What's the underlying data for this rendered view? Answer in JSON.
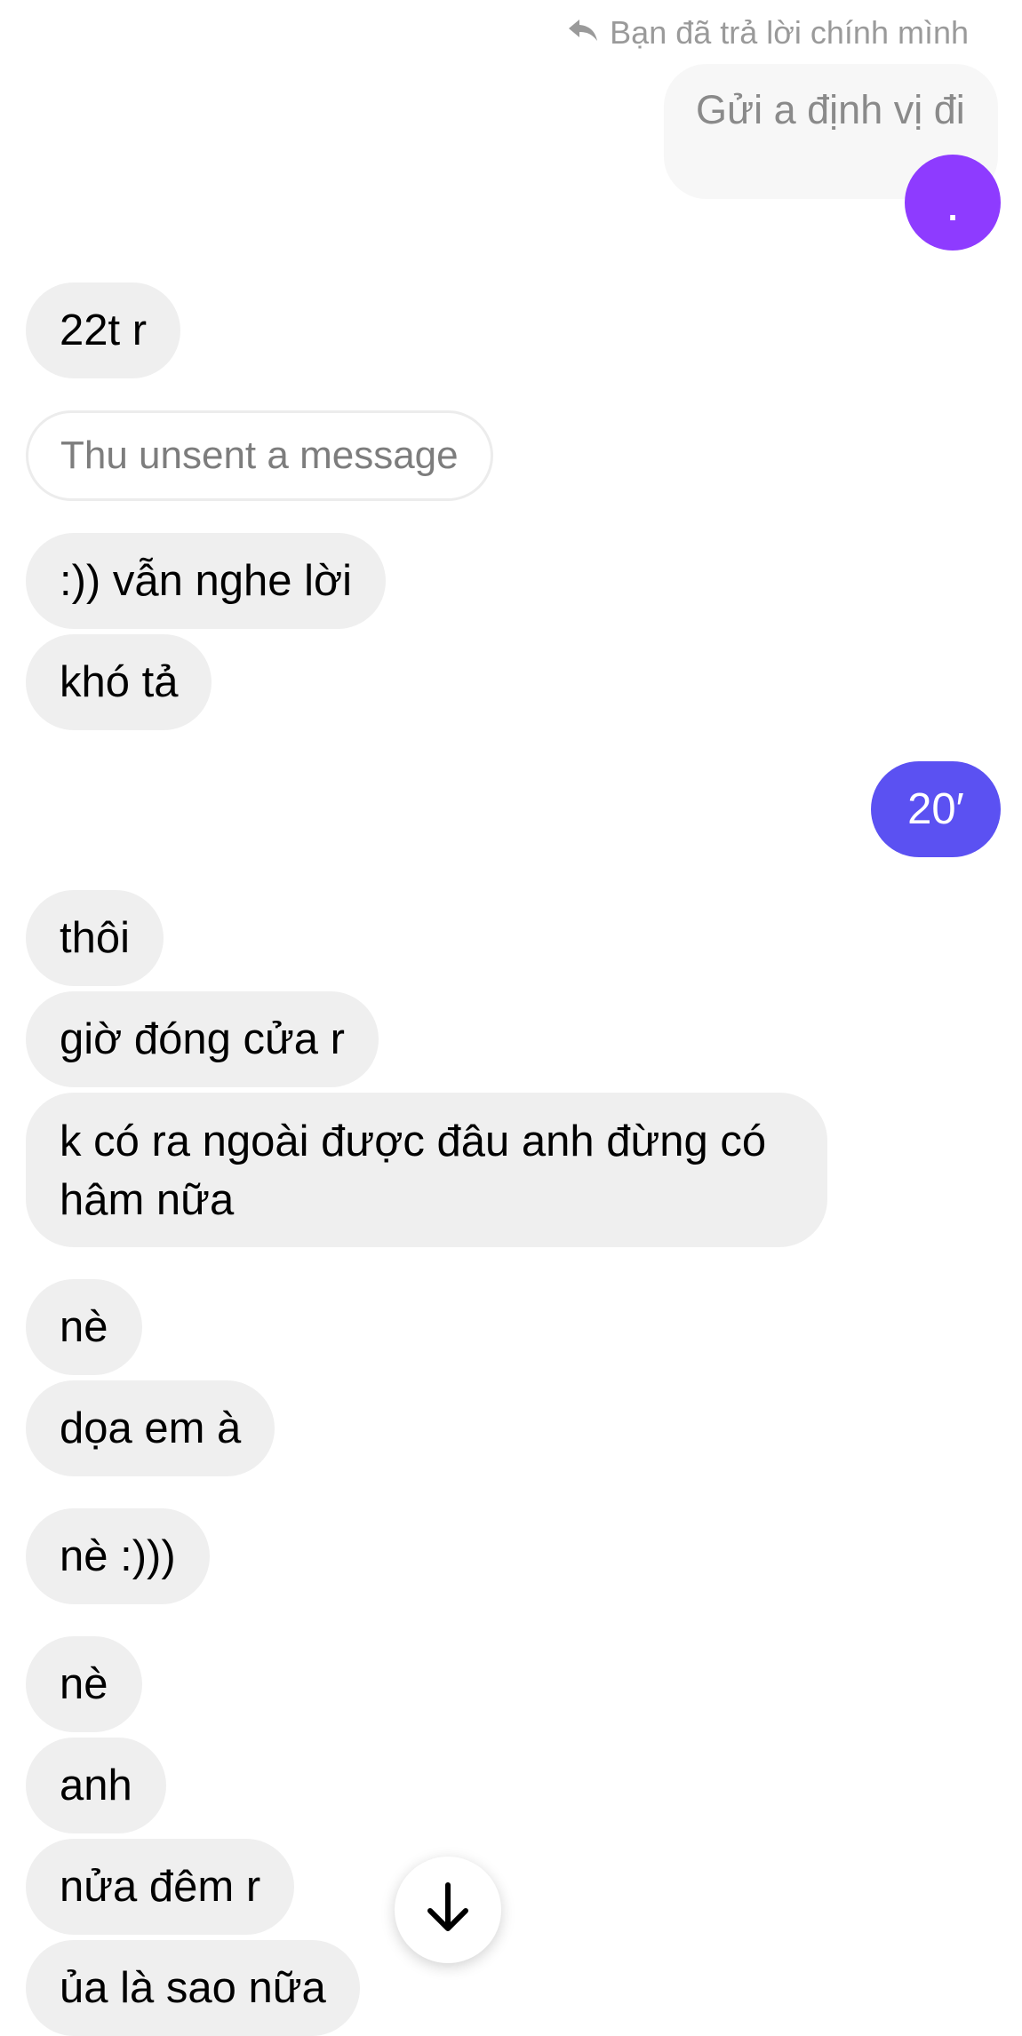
{
  "reply_context": {
    "note": "Bạn đã trả lời chính mình",
    "quoted_text": "Gửi a định vị đi",
    "sent_text": "."
  },
  "messages": [
    {
      "side": "received",
      "text": "22t r"
    },
    {
      "side": "system",
      "text": "Thu unsent a message"
    },
    {
      "side": "received",
      "text": ":)) vẫn nghe lời"
    },
    {
      "side": "received",
      "text": "khó tả"
    },
    {
      "side": "sent",
      "text": "20′"
    },
    {
      "side": "received",
      "text": "thôi"
    },
    {
      "side": "received",
      "text": "giờ đóng cửa r"
    },
    {
      "side": "received",
      "text": "k có ra ngoài được đâu anh đừng có hâm nữa"
    },
    {
      "side": "received",
      "text": "nè"
    },
    {
      "side": "received",
      "text": "dọa em à"
    },
    {
      "side": "received",
      "text": "nè :)))"
    },
    {
      "side": "received",
      "text": "nè"
    },
    {
      "side": "received",
      "text": "anh"
    },
    {
      "side": "received",
      "text": "nửa đêm r"
    },
    {
      "side": "received",
      "text": "ủa là sao nữa"
    }
  ],
  "icons": {
    "reply": "reply-arrow-icon",
    "scroll_down": "arrow-down-icon"
  },
  "colors": {
    "sent_bubble": "#5b51f2",
    "reply_dot": "#8e3bff",
    "received_bubble": "#efefef"
  }
}
